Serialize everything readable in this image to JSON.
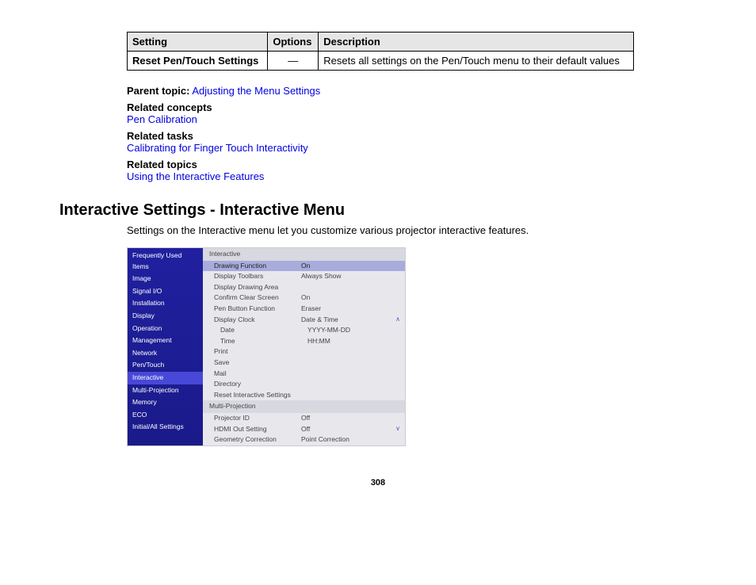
{
  "table": {
    "headers": [
      "Setting",
      "Options",
      "Description"
    ],
    "rows": [
      {
        "setting": "Reset Pen/Touch Settings",
        "options": "—",
        "description": "Resets all settings on the Pen/Touch menu to their default values"
      }
    ]
  },
  "parent_topic_label": "Parent topic:",
  "parent_topic_link": "Adjusting the Menu Settings",
  "related_concepts_label": "Related concepts",
  "related_concepts_link": "Pen Calibration",
  "related_tasks_label": "Related tasks",
  "related_tasks_link": "Calibrating for Finger Touch Interactivity",
  "related_topics_label": "Related topics",
  "related_topics_link": "Using the Interactive Features",
  "section_heading": "Interactive Settings - Interactive Menu",
  "section_desc": "Settings on the Interactive menu let you customize various projector interactive features.",
  "menu": {
    "sidebar": [
      "Frequently Used Items",
      "Image",
      "Signal I/O",
      "Installation",
      "Display",
      "Operation",
      "Management",
      "Network",
      "Pen/Touch",
      "Interactive",
      "Multi-Projection",
      "Memory",
      "ECO",
      "Initial/All Settings"
    ],
    "sidebar_selected": "Interactive",
    "sections": [
      {
        "title": "Interactive",
        "rows": [
          {
            "label": "Drawing Function",
            "value": "On",
            "highlight": true
          },
          {
            "label": "Display Toolbars",
            "value": "Always Show"
          },
          {
            "label": "Display Drawing Area",
            "value": ""
          },
          {
            "label": "Confirm Clear Screen",
            "value": "On"
          },
          {
            "label": "Pen Button Function",
            "value": "Eraser"
          },
          {
            "label": "Display Clock",
            "value": "Date & Time",
            "chev": "up"
          },
          {
            "label": "Date",
            "value": "YYYY-MM-DD",
            "sub": true
          },
          {
            "label": "Time",
            "value": "HH:MM",
            "sub": true
          },
          {
            "label": "Print",
            "value": ""
          },
          {
            "label": "Save",
            "value": ""
          },
          {
            "label": "Mail",
            "value": ""
          },
          {
            "label": "Directory",
            "value": ""
          },
          {
            "label": "Reset Interactive Settings",
            "value": ""
          }
        ]
      },
      {
        "title": "Multi-Projection",
        "rows": [
          {
            "label": "Projector ID",
            "value": "Off"
          },
          {
            "label": "HDMI Out Setting",
            "value": "Off",
            "chev": "down"
          },
          {
            "label": "Geometry Correction",
            "value": "Point Correction"
          }
        ]
      }
    ]
  },
  "page_number": "308"
}
